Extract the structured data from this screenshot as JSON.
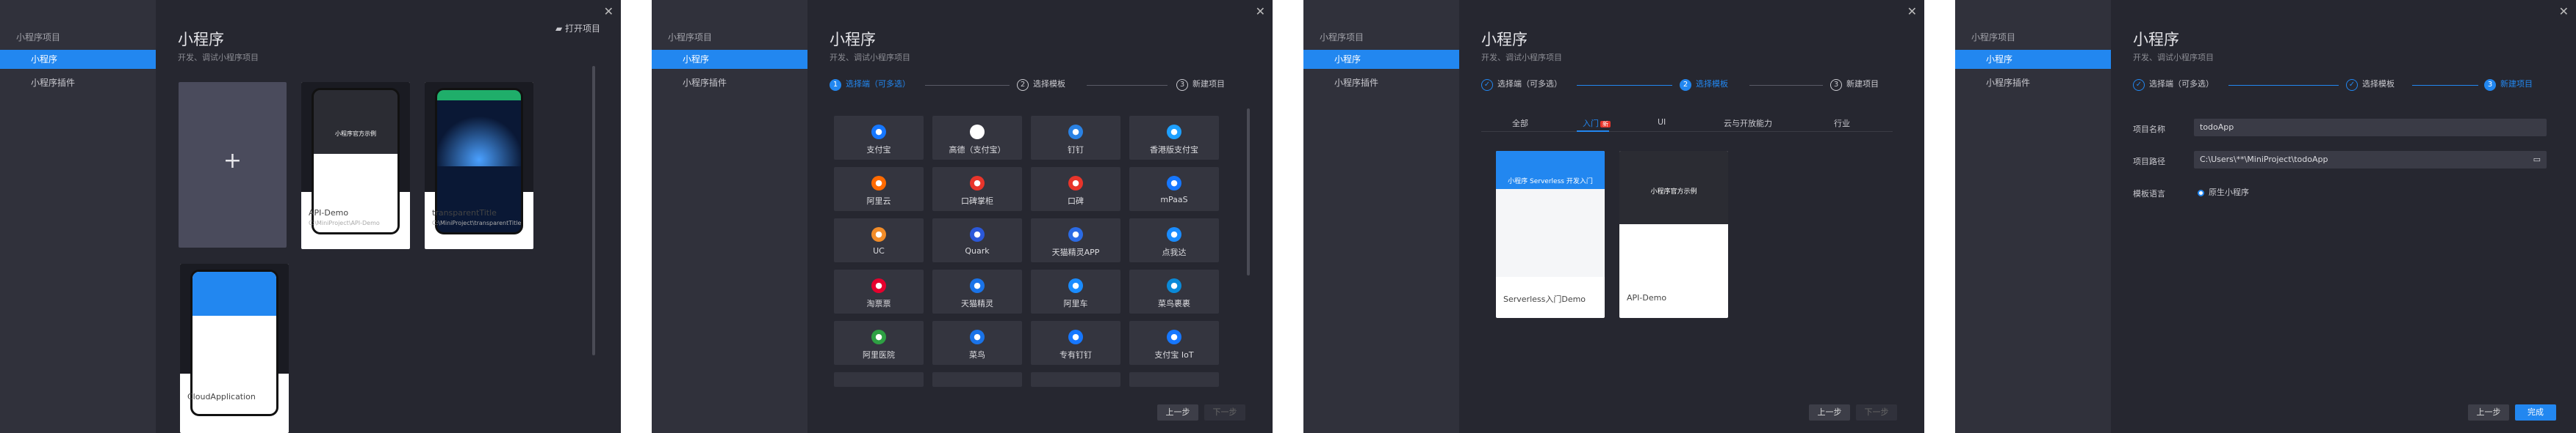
{
  "sidebar": {
    "group": "小程序项目",
    "items": [
      "小程序",
      "小程序插件"
    ]
  },
  "header": {
    "title": "小程序",
    "subtitle": "开发、调试小程序项目"
  },
  "panel1": {
    "open_project": "打开项目",
    "cards": [
      {
        "name": "API-Demo",
        "path": "C:\\MiniProject\\API-Demo"
      },
      {
        "name": "transparentTitle",
        "path": "C:\\MiniProject\\transparentTitle"
      },
      {
        "name": "CloudApplication",
        "path": ""
      }
    ],
    "phone_title": "小程序官方示例"
  },
  "steps": [
    "选择端（可多选）",
    "选择模板",
    "新建项目"
  ],
  "panel2": {
    "platforms": [
      "支付宝",
      "高德（支付宝）",
      "钉钉",
      "香港版支付宝",
      "阿里云",
      "口碑掌柜",
      "口碑",
      "mPaaS",
      "UC",
      "Quark",
      "天猫精灵APP",
      "点我达",
      "淘票票",
      "天猫精灵",
      "阿里车",
      "菜鸟裹裹",
      "阿里医院",
      "菜鸟",
      "专有钉钉",
      "支付宝 IoT"
    ],
    "icon_colors": [
      "#1677ff",
      "#ffffff",
      "#2a82e4",
      "#1ea0ff",
      "#ff6a00",
      "#e8352b",
      "#e8352b",
      "#1677ff",
      "#f28c28",
      "#2b58d9",
      "#2b6be5",
      "#1a8cff",
      "#e6002d",
      "#1a73e8",
      "#1a8cff",
      "#0a8ad8",
      "#2ea043",
      "#1a73e8",
      "#1677ff",
      "#1677ff"
    ],
    "prev": "上一步",
    "next": "下一步"
  },
  "panel3": {
    "tabs": [
      "全部",
      "入门",
      "UI",
      "云与开放能力",
      "行业"
    ],
    "tab_badge": "新",
    "templates": [
      {
        "name": "Serverless入门Demo",
        "phone_title": "小程序 Serverless 开发入门"
      },
      {
        "name": "API-Demo",
        "phone_title": "小程序官方示例"
      }
    ],
    "prev": "上一步",
    "next": "下一步"
  },
  "panel4": {
    "fields": [
      {
        "label": "项目名称",
        "value": "todoApp"
      },
      {
        "label": "项目路径",
        "value": "C:\\Users\\**\\MiniProject\\todoApp"
      },
      {
        "label": "模板语言",
        "value": "原生小程序"
      }
    ],
    "prev": "上一步",
    "finish": "完成"
  }
}
